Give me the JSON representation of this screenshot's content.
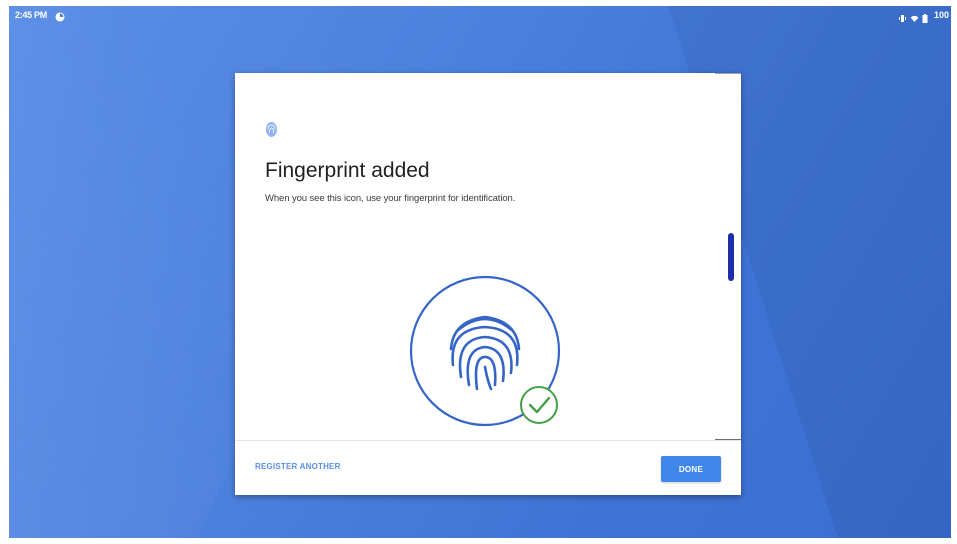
{
  "status_bar": {
    "time": "2:45 PM",
    "battery_text": "100",
    "icons": [
      "app-notification-icon",
      "vibrate-icon",
      "wifi-icon",
      "battery-icon"
    ]
  },
  "dialog": {
    "title": "Fingerprint added",
    "description": "When you see this icon, use your fingerprint for identification.",
    "header_icon": "fingerprint-icon",
    "graphic": "fingerprint-check-icon",
    "register_label": "REGISTER ANOTHER",
    "done_label": "DONE"
  },
  "colors": {
    "background": "#4c80de",
    "accent": "#3f86e8",
    "link": "#5b8ee6",
    "fingerprint": "#3565c7",
    "check": "#43a047",
    "scrollbar": "#1f2fa8"
  }
}
